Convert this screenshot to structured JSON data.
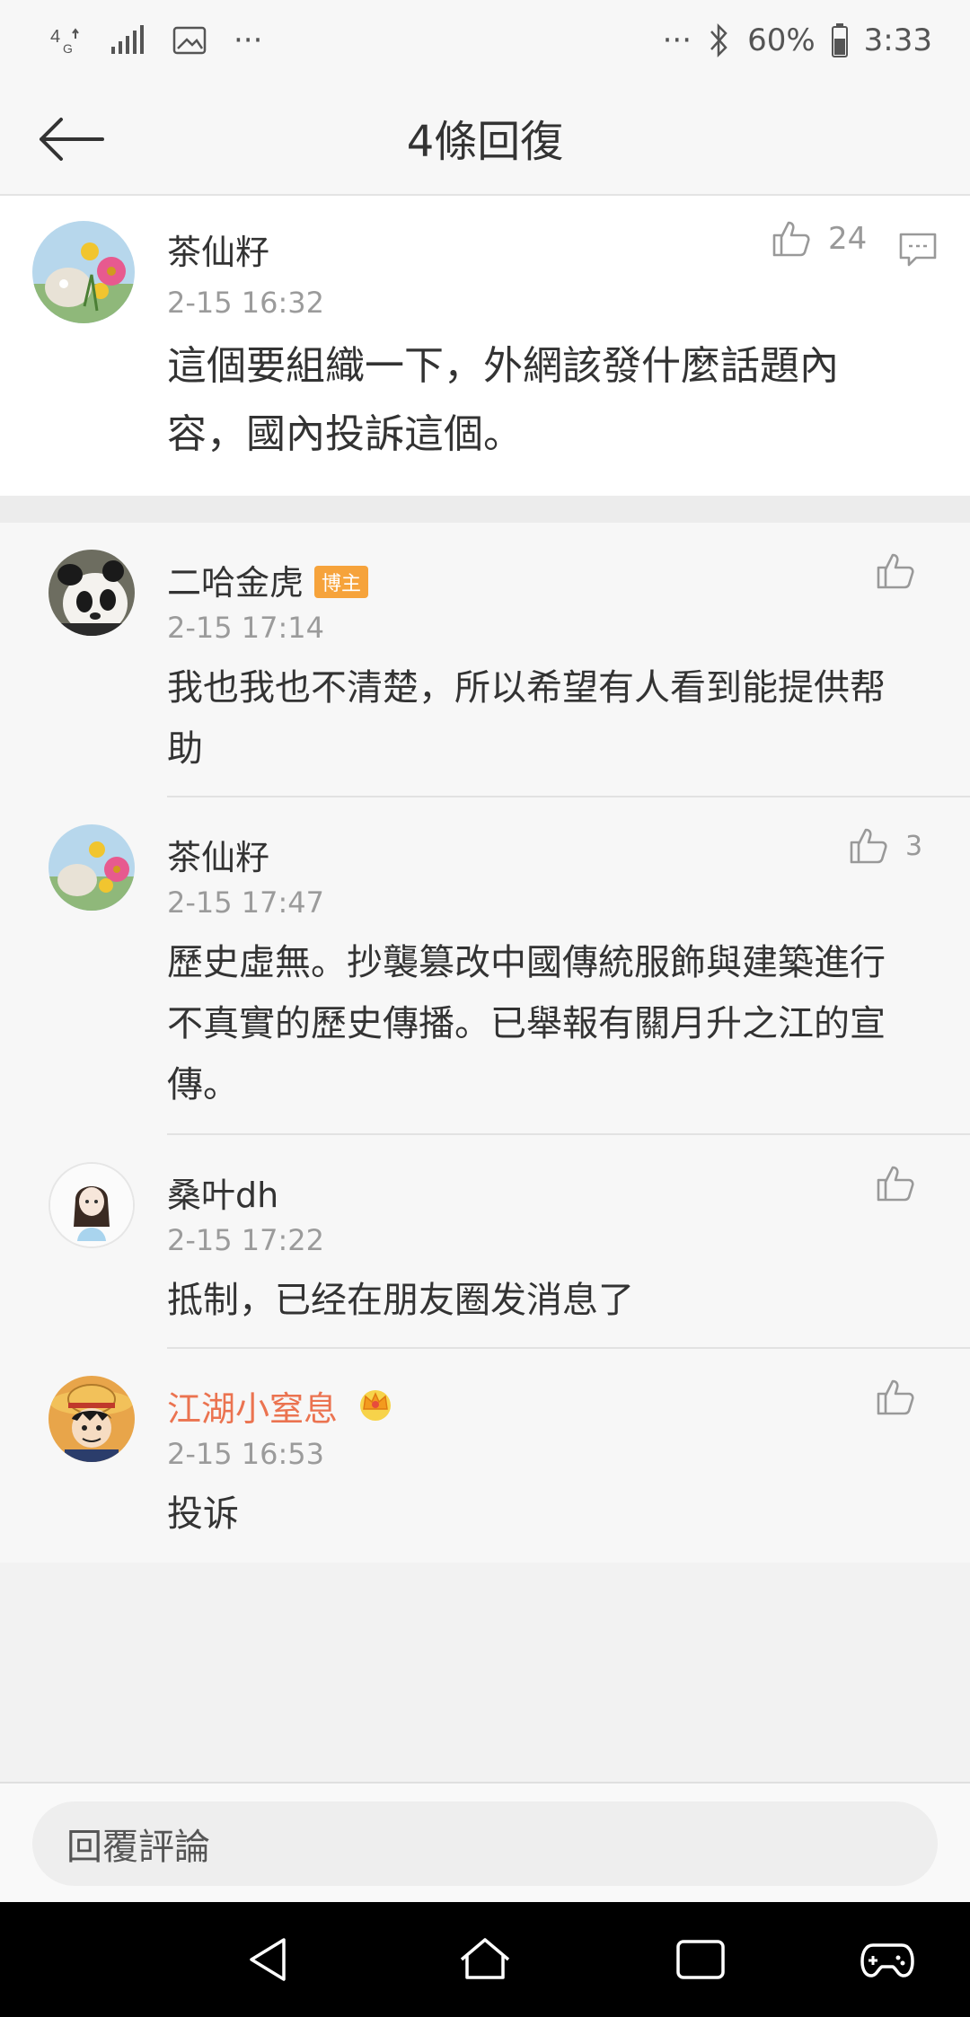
{
  "status_bar": {
    "network": "4G",
    "dots_left": "···",
    "dots_right": "···",
    "battery": "60%",
    "time": "3:33"
  },
  "header": {
    "title": "4條回復"
  },
  "root_comment": {
    "username": "茶仙籽",
    "time": "2-15 16:32",
    "likes": "24",
    "content_line1": "這個要組織一下，外網該發什麼話題內",
    "content_line2": "容，國內投訴這個。"
  },
  "replies": [
    {
      "username": "二哈金虎",
      "badge": "博主",
      "time": "2-15 17:14",
      "likes": "",
      "content_lines": [
        "我也我也不清楚，所以希望有人看到能提供帮",
        "助"
      ]
    },
    {
      "username": "茶仙籽",
      "time": "2-15 17:47",
      "likes": "3",
      "content_lines": [
        "歷史虛無。抄襲篡改中國傳統服飾與建築進行",
        "不真實的歷史傳播。已舉報有關月升之江的宣",
        "傳。"
      ]
    },
    {
      "username": "桑叶dh",
      "time": "2-15 17:22",
      "likes": "",
      "content_lines": [
        "抵制，已经在朋友圈发消息了"
      ]
    },
    {
      "username": "江湖小窒息",
      "time": "2-15 16:53",
      "likes": "",
      "username_color": "#eb7350",
      "content_lines": [
        "投诉"
      ]
    }
  ],
  "reply_bar": {
    "placeholder": "回覆評論"
  },
  "colors": {
    "accent_orange": "#eb7350",
    "badge_orange": "#f6a33b",
    "muted": "#9b9b9b"
  },
  "icons": {
    "back": "back-arrow-icon",
    "like": "thumb-up-icon",
    "comment": "comment-icon",
    "crown": "vip-crown-icon"
  }
}
